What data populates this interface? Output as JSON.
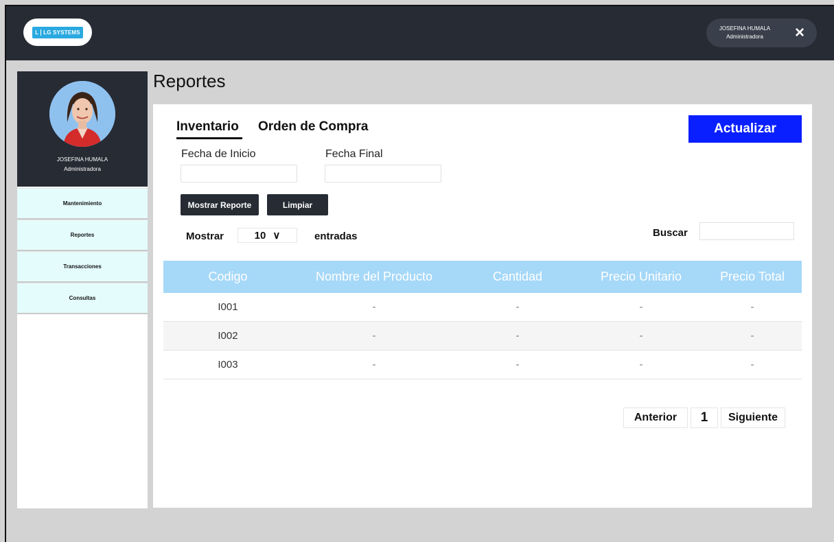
{
  "header": {
    "logo": {
      "letter": "L",
      "text": "LG SYSTEMS"
    },
    "user": {
      "name": "JOSEFINA HUMALA",
      "role": "Administradora"
    },
    "close_icon": "×"
  },
  "sidebar": {
    "profile": {
      "name": "JOSEFINA HUMALA",
      "role": "Administradora"
    },
    "items": [
      {
        "label": "Mantenimiento"
      },
      {
        "label": "Reportes"
      },
      {
        "label": "Transacciones"
      },
      {
        "label": "Consultas"
      }
    ]
  },
  "main": {
    "title": "Reportes",
    "tabs": [
      {
        "label": "Inventario",
        "active": true
      },
      {
        "label": "Orden de Compra",
        "active": false
      }
    ],
    "update_button": "Actualizar",
    "filters": {
      "start_label": "Fecha de Inicio",
      "end_label": "Fecha Final",
      "start_value": "",
      "end_value": ""
    },
    "show_report_button": "Mostrar Reporte",
    "clear_button": "Limpiar",
    "entries": {
      "show_label": "Mostrar",
      "value": "10",
      "chevron": "∨",
      "suffix": "entradas"
    },
    "search": {
      "label": "Buscar",
      "value": ""
    },
    "table": {
      "columns": [
        "Codigo",
        "Nombre del Producto",
        "Cantidad",
        "Precio Unitario",
        "Precio Total"
      ],
      "rows": [
        [
          "I001",
          "-",
          "-",
          "-",
          "-"
        ],
        [
          "I002",
          "-",
          "-",
          "-",
          "-"
        ],
        [
          "I003",
          "-",
          "-",
          "-",
          "-"
        ]
      ]
    },
    "pagination": {
      "prev": "Anterior",
      "page": "1",
      "next": "Siguiente"
    }
  },
  "colors": {
    "topbar": "#262b34",
    "accent_button": "#0a1fff",
    "table_header": "#a6d8f8",
    "nav_item": "#e5fcfc"
  }
}
